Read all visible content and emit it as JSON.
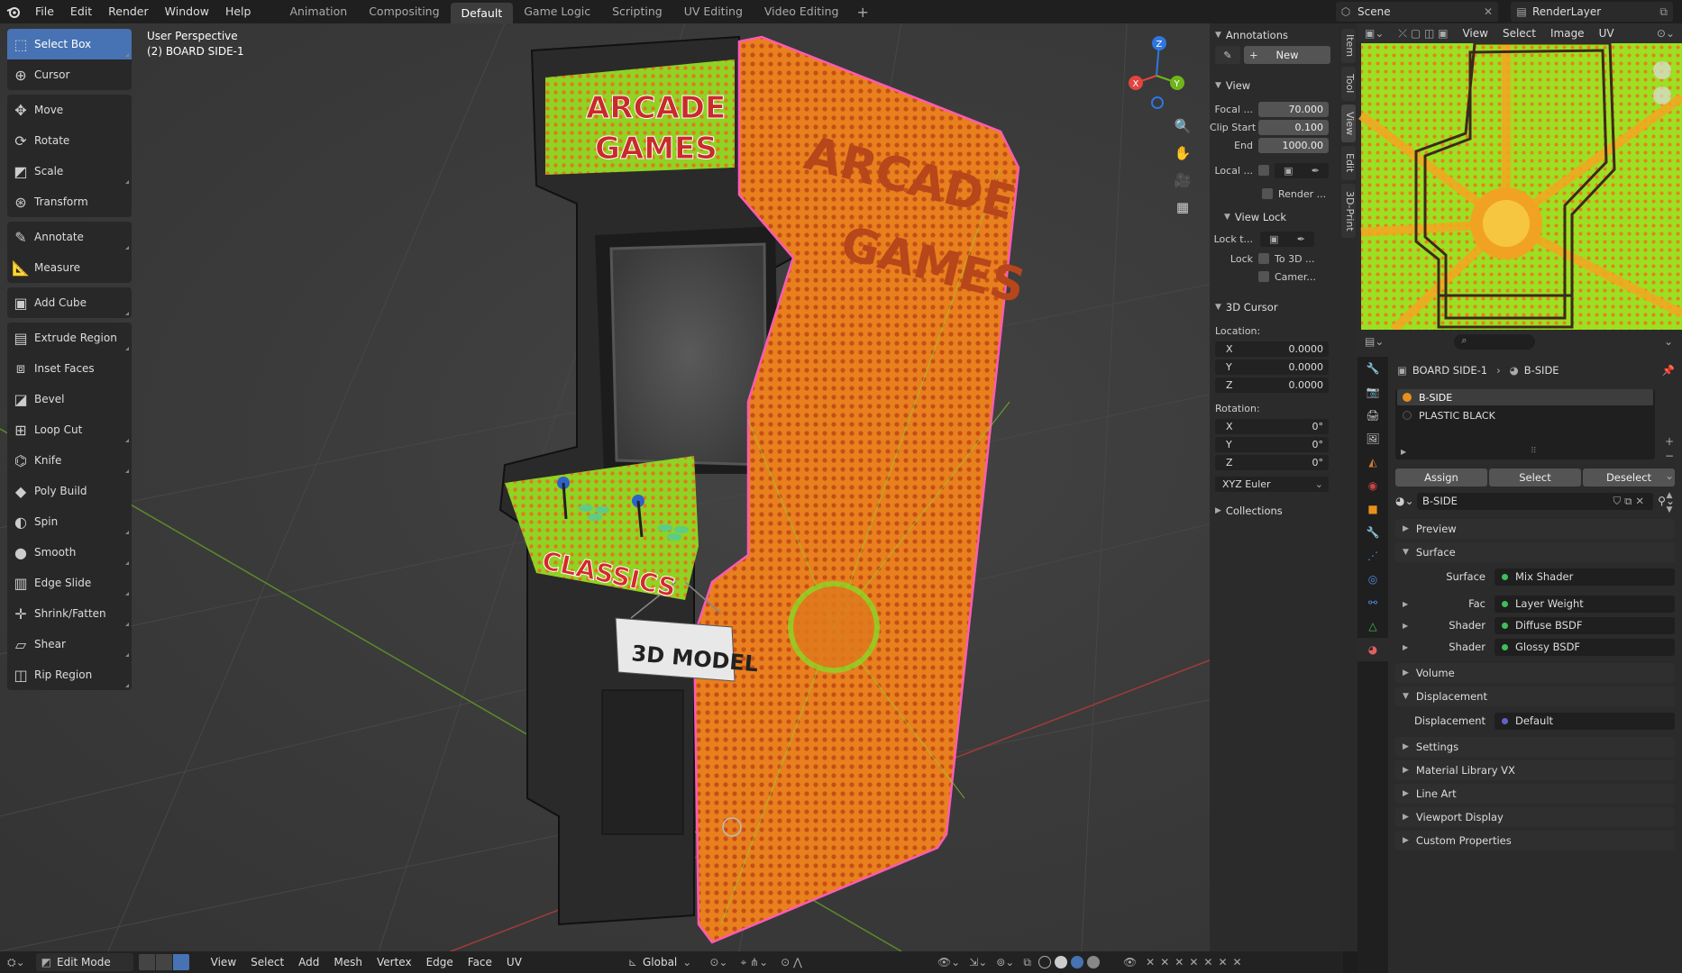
{
  "topbar": {
    "menus": [
      "File",
      "Edit",
      "Render",
      "Window",
      "Help"
    ],
    "workspaces": [
      "Animation",
      "Compositing",
      "Default",
      "Game Logic",
      "Scripting",
      "UV Editing",
      "Video Editing"
    ],
    "active_workspace": "Default",
    "scene": "Scene",
    "view_layer": "RenderLayer"
  },
  "viewport": {
    "info_line1": "User Perspective",
    "info_line2": "(2) BOARD SIDE-1",
    "gizmo_axes": [
      "X",
      "Y",
      "Z"
    ],
    "tools": [
      {
        "label": "Select Box",
        "icon": "select-box-icon",
        "active": true
      },
      {
        "label": "Cursor",
        "icon": "cursor-icon"
      },
      {
        "label": "Move",
        "icon": "move-icon"
      },
      {
        "label": "Rotate",
        "icon": "rotate-icon"
      },
      {
        "label": "Scale",
        "icon": "scale-icon"
      },
      {
        "label": "Transform",
        "icon": "transform-icon"
      },
      {
        "label": "Annotate",
        "icon": "annotate-icon"
      },
      {
        "label": "Measure",
        "icon": "measure-icon"
      },
      {
        "label": "Add Cube",
        "icon": "add-cube-icon"
      },
      {
        "label": "Extrude Region",
        "icon": "extrude-icon"
      },
      {
        "label": "Inset Faces",
        "icon": "inset-icon"
      },
      {
        "label": "Bevel",
        "icon": "bevel-icon"
      },
      {
        "label": "Loop Cut",
        "icon": "loop-cut-icon"
      },
      {
        "label": "Knife",
        "icon": "knife-icon"
      },
      {
        "label": "Poly Build",
        "icon": "poly-build-icon"
      },
      {
        "label": "Spin",
        "icon": "spin-icon"
      },
      {
        "label": "Smooth",
        "icon": "smooth-icon"
      },
      {
        "label": "Edge Slide",
        "icon": "edge-slide-icon"
      },
      {
        "label": "Shrink/Fatten",
        "icon": "shrink-fatten-icon"
      },
      {
        "label": "Shear",
        "icon": "shear-icon"
      },
      {
        "label": "Rip Region",
        "icon": "rip-region-icon"
      }
    ],
    "cabinet_texts": {
      "marquee": [
        "ARCADE",
        "GAMES"
      ],
      "side": [
        "ARCADE",
        "GAMES"
      ],
      "panel": "CLASSICS",
      "sign": "3D MODEL"
    }
  },
  "side_tabs": [
    "Item",
    "Tool",
    "View",
    "Edit",
    "3D-Print"
  ],
  "npanel": {
    "annotations_title": "Annotations",
    "new_label": "New",
    "view_title": "View",
    "focal_label": "Focal ...",
    "focal_value": "70.000",
    "clip_start_label": "Clip Start",
    "clip_start_value": "0.100",
    "end_label": "End",
    "end_value": "1000.00",
    "local_label": "Local ...",
    "render_label": "Render ...",
    "view_lock_title": "View Lock",
    "lock_to_label": "Lock t...",
    "lock_label": "Lock",
    "to_3d_label": "To 3D ...",
    "camera_label": "Camer...",
    "cursor_title": "3D Cursor",
    "location_label": "Location:",
    "loc_x": "0.0000",
    "loc_y": "0.0000",
    "loc_z": "0.0000",
    "rotation_label": "Rotation:",
    "rot_x": "0°",
    "rot_y": "0°",
    "rot_z": "0°",
    "rotation_mode": "XYZ Euler",
    "collections_title": "Collections",
    "axis_x": "X",
    "axis_y": "Y",
    "axis_z": "Z"
  },
  "bottombar": {
    "mode": "Edit Mode",
    "menus": [
      "View",
      "Select",
      "Add",
      "Mesh",
      "Vertex",
      "Edge",
      "Face",
      "UV"
    ],
    "orientation": "Global"
  },
  "image_editor": {
    "menus": [
      "View",
      "Select",
      "Image",
      "UV"
    ]
  },
  "properties": {
    "breadcrumb_object": "BOARD SIDE-1",
    "breadcrumb_material": "B-SIDE",
    "slots": [
      "B-SIDE",
      "PLASTIC BLACK"
    ],
    "assign_label": "Assign",
    "select_label": "Select",
    "deselect_label": "Deselect",
    "material_name": "B-SIDE",
    "sections": {
      "preview": "Preview",
      "surface": "Surface",
      "volume": "Volume",
      "displacement": "Displacement",
      "settings": "Settings",
      "library": "Material Library VX",
      "lineart": "Line Art",
      "viewport_display": "Viewport Display",
      "custom_props": "Custom Properties"
    },
    "surface_rows": [
      {
        "label": "Surface",
        "value": "Mix Shader",
        "color": "#3fbf5a"
      },
      {
        "label": "Fac",
        "value": "Layer Weight",
        "color": "#3fbf5a"
      },
      {
        "label": "Shader",
        "value": "Diffuse BSDF",
        "color": "#3fbf5a"
      },
      {
        "label": "Shader",
        "value": "Glossy BSDF",
        "color": "#3fbf5a"
      }
    ],
    "displacement_row": {
      "label": "Displacement",
      "value": "Default",
      "color": "#6363c7"
    }
  },
  "colors": {
    "accent": "#4772b3",
    "selected_outline": "#ff5ab4",
    "texture_orange": "#e8801e",
    "texture_green": "#86d21e"
  }
}
